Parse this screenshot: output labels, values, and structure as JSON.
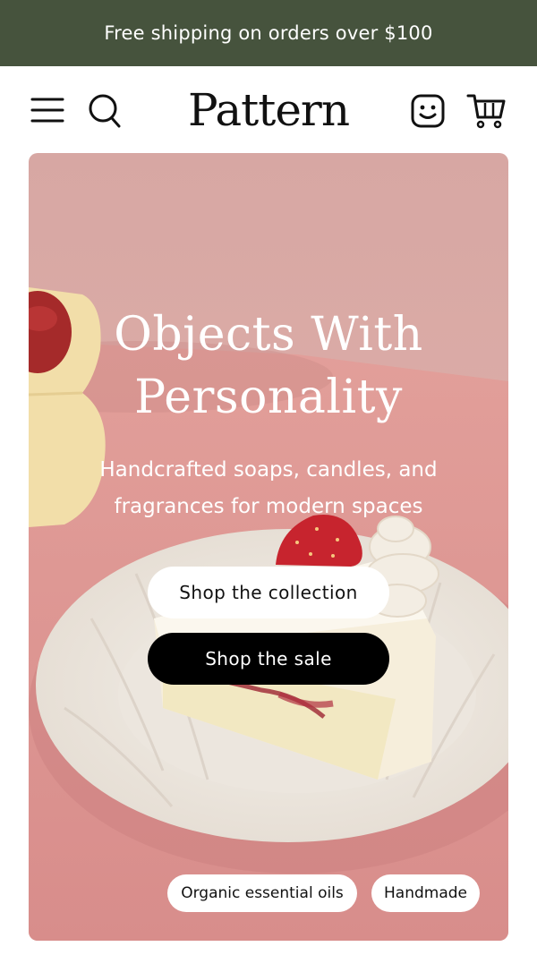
{
  "announcement": {
    "text": "Free shipping on orders over $100"
  },
  "header": {
    "logo": "Pattern",
    "icons": [
      "menu-icon",
      "search-icon",
      "account-icon",
      "cart-icon"
    ]
  },
  "hero": {
    "title_line1": "Objects With",
    "title_line2": "Personality",
    "subtitle_line1": "Handcrafted soaps, candles, and",
    "subtitle_line2": "fragrances for modern spaces",
    "primary_button": "Shop the collection",
    "secondary_button": "Shop the sale",
    "tags": [
      "Organic essential oils",
      "Handmade"
    ]
  },
  "colors": {
    "announcement_bg": "#46533d",
    "hero_bg": "#d99a98",
    "button_dark": "#000000"
  }
}
